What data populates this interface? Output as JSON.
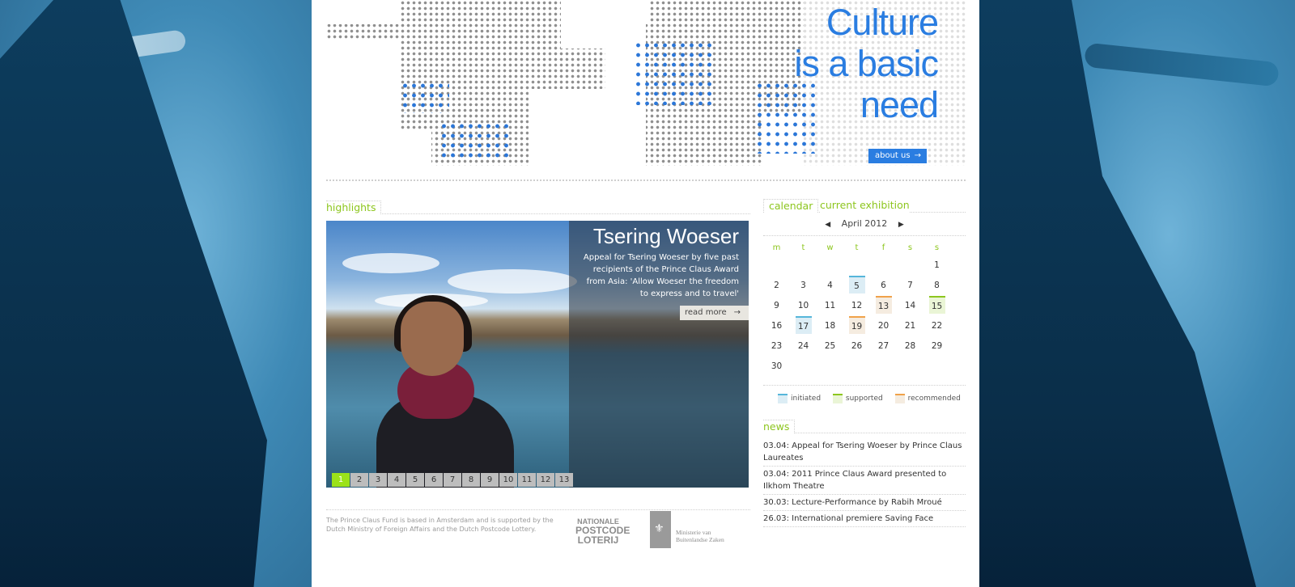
{
  "header": {
    "tagline": [
      "Culture",
      "is a basic",
      "need"
    ],
    "about_button": "about us",
    "arrow": "→"
  },
  "highlights": {
    "label": "highlights",
    "slide": {
      "title": "Tsering Woeser",
      "text": "Appeal for Tsering Woeser by five past recipients of the Prince Claus Award from Asia: 'Allow Woeser the freedom to express and to travel'",
      "read_more": "read more"
    },
    "pages": [
      "1",
      "2",
      "3",
      "4",
      "5",
      "6",
      "7",
      "8",
      "9",
      "10",
      "11",
      "12",
      "13"
    ],
    "active_page": "1"
  },
  "footer": {
    "text": "The Prince Claus Fund is based in Amsterdam and is supported by the Dutch Ministry of Foreign Affairs and the Dutch Postcode Lottery.",
    "postcode_logo": [
      "NATIONALE",
      "POSTCODE",
      "LOTERIJ"
    ],
    "ministry_logo": [
      "Ministerie van",
      "Buitenlandse Zaken"
    ]
  },
  "calendar": {
    "tab_calendar": "calendar",
    "tab_exhibition": "current exhibition",
    "month": "April 2012",
    "prev": "◀",
    "next": "▶",
    "weekdays": [
      "m",
      "t",
      "w",
      "t",
      "f",
      "s",
      "s"
    ],
    "weeks": [
      [
        "",
        "",
        "",
        "",
        "",
        "",
        "1"
      ],
      [
        "2",
        "3",
        "4",
        "5",
        "6",
        "7",
        "8"
      ],
      [
        "9",
        "10",
        "11",
        "12",
        "13",
        "14",
        "15"
      ],
      [
        "16",
        "17",
        "18",
        "19",
        "20",
        "21",
        "22"
      ],
      [
        "23",
        "24",
        "25",
        "26",
        "27",
        "28",
        "29"
      ],
      [
        "30",
        "",
        "",
        "",
        "",
        "",
        ""
      ]
    ],
    "events": {
      "5": "i",
      "17": "i",
      "15": "s",
      "13": "r",
      "19": "r"
    },
    "legend": [
      "initiated",
      "supported",
      "recommended"
    ],
    "colors": {
      "initiated": "#56b6da",
      "supported": "#8dc61e",
      "recommended": "#f0a24a"
    }
  },
  "news": {
    "label": "news",
    "items": [
      "03.04: Appeal for Tsering Woeser by Prince Claus Laureates",
      "03.04: 2011 Prince Claus Award presented to Ilkhom Theatre",
      "30.03: Lecture-Performance by Rabih Mroué",
      "26.03: International premiere Saving Face"
    ]
  },
  "colors": {
    "accent": "#2a7de1",
    "green": "#8dc61e"
  }
}
